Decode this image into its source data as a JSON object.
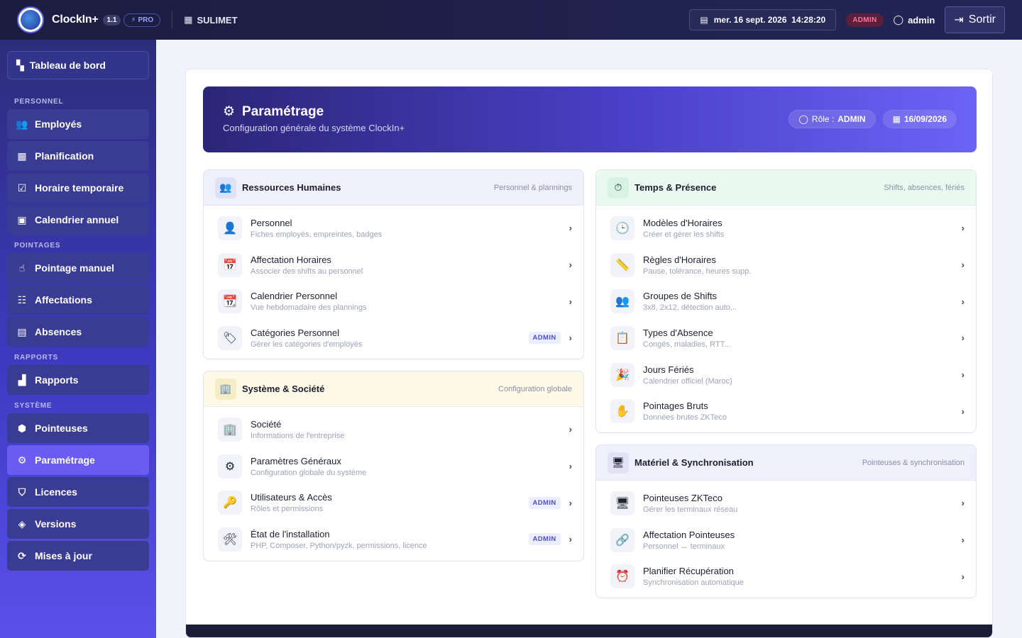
{
  "topbar": {
    "brand": "ClockIn+",
    "version": "1.1",
    "pro": "PRO",
    "company": "SULIMET",
    "datetime": "mer. 16 sept. 2026  14:28:20",
    "role_badge": "ADMIN",
    "user": "admin",
    "logout": "Sortir"
  },
  "sidebar": {
    "dashboard": "Tableau de bord",
    "sections": [
      {
        "label": "PERSONNEL",
        "items": [
          "Employés",
          "Planification",
          "Horaire temporaire",
          "Calendrier annuel"
        ]
      },
      {
        "label": "POINTAGES",
        "items": [
          "Pointage manuel",
          "Affectations",
          "Absences"
        ]
      },
      {
        "label": "RAPPORTS",
        "items": [
          "Rapports"
        ]
      },
      {
        "label": "SYSTÈME",
        "items": [
          "Pointeuses",
          "Paramétrage",
          "Licences",
          "Versions",
          "Mises à jour"
        ]
      }
    ]
  },
  "hero": {
    "title": "Paramétrage",
    "subtitle": "Configuration générale du système ClockIn+",
    "role_label": "Rôle :",
    "role_value": "ADMIN",
    "date": "16/09/2026"
  },
  "panels": {
    "rh": {
      "title": "Ressources Humaines",
      "tag": "Personnel & plannings",
      "rows": [
        {
          "title": "Personnel",
          "desc": "Fiches employés, empreintes, badges"
        },
        {
          "title": "Affectation Horaires",
          "desc": "Associer des shifts au personnel"
        },
        {
          "title": "Calendrier Personnel",
          "desc": "Vue hebdomadaire des plannings"
        },
        {
          "title": "Catégories Personnel",
          "desc": "Gérer les catégories d'employés",
          "badge": "ADMIN"
        }
      ]
    },
    "sys": {
      "title": "Système & Société",
      "tag": "Configuration globale",
      "rows": [
        {
          "title": "Société",
          "desc": "Informations de l'entreprise"
        },
        {
          "title": "Paramètres Généraux",
          "desc": "Configuration globale du système"
        },
        {
          "title": "Utilisateurs & Accès",
          "desc": "Rôles et permissions",
          "badge": "ADMIN"
        },
        {
          "title": "État de l'installation",
          "desc": "PHP, Composer, Python/pyzk, permissions, licence",
          "badge": "ADMIN"
        }
      ]
    },
    "tp": {
      "title": "Temps & Présence",
      "tag": "Shifts, absences, fériés",
      "rows": [
        {
          "title": "Modèles d'Horaires",
          "desc": "Créer et gérer les shifts"
        },
        {
          "title": "Règles d'Horaires",
          "desc": "Pause, tolérance, heures supp."
        },
        {
          "title": "Groupes de Shifts",
          "desc": "3x8, 2x12, détection auto..."
        },
        {
          "title": "Types d'Absence",
          "desc": "Congés, maladies, RTT..."
        },
        {
          "title": "Jours Fériés",
          "desc": "Calendrier officiel (Maroc)"
        },
        {
          "title": "Pointages Bruts",
          "desc": "Données brutes ZKTeco"
        }
      ]
    },
    "mat": {
      "title": "Matériel & Synchronisation",
      "tag": "Pointeuses & synchronisation",
      "rows": [
        {
          "title": "Pointeuses ZKTeco",
          "desc": "Gérer les terminaux réseau"
        },
        {
          "title": "Affectation Pointeuses",
          "desc": "Personnel ↔ terminaux"
        },
        {
          "title": "Planifier Récupération",
          "desc": "Synchronisation automatique"
        }
      ]
    }
  },
  "chevron": "›",
  "colors": {
    "accent": "#5b50ea",
    "sidebar_active": "#6a5cf0",
    "header": "#1b1d40"
  }
}
